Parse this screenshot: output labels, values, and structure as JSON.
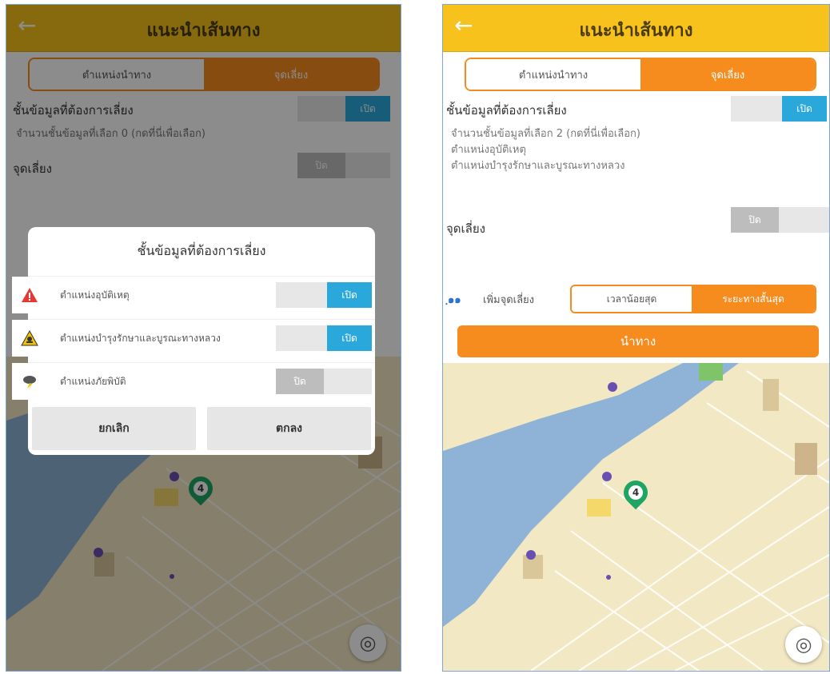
{
  "left": {
    "appbar": {
      "back_icon": "←",
      "title": "แนะนำเส้นทาง"
    },
    "tabs": [
      "ตำแหน่งนำทาง",
      "จุดเลี่ยง"
    ],
    "layers_label": "ชั้นข้อมูลที่ต้องการเลี่ยง",
    "layers_toggle": "เปิด",
    "layers_count": "จำนวนชั้นข้อมูลที่เลือก 0 (กดที่นี่เพื่อเลือก)",
    "avoid_label": "จุดเลี่ยง",
    "avoid_toggle": "ปิด",
    "dialog": {
      "title": "ชั้นข้อมูลที่ต้องการเลี่ยง",
      "rows": [
        {
          "label": "ตำแหน่งอุบัติเหตุ",
          "toggle": "เปิด",
          "icon": "warning-icon"
        },
        {
          "label": "ตำแหน่งบำรุงรักษาและบูรณะทางหลวง",
          "toggle": "เปิด",
          "icon": "construction-icon"
        },
        {
          "label": "ตำแหน่งภัยพิบัติ",
          "toggle": "ปิด",
          "icon": "storm-icon"
        }
      ],
      "cancel": "ยกเลิก",
      "ok": "ตกลง"
    },
    "marker_number": "4",
    "locate_icon": "◎"
  },
  "right": {
    "appbar": {
      "back_icon": "←",
      "title": "แนะนำเส้นทาง"
    },
    "tabs": [
      "ตำแหน่งนำทาง",
      "จุดเลี่ยง"
    ],
    "layers_label": "ชั้นข้อมูลที่ต้องการเลี่ยง",
    "layers_toggle": "เปิด",
    "layers_count": "จำนวนชั้นข้อมูลที่เลือก 2 (กดที่นี่เพื่อเลือก)",
    "layer_items": [
      "ตำแหน่งอุบัติเหตุ",
      "ตำแหน่งบำรุงรักษาและบูรณะทางหลวง"
    ],
    "avoid_label": "จุดเลี่ยง",
    "avoid_toggle": "ปิด",
    "route_icon": "ฺ๑๑",
    "add_stop_label": "เพิ่มจุดเลี่ยง",
    "route_options": [
      "เวลาน้อยสุด",
      "ระยะทางสั้นสุด"
    ],
    "navigate": "นำทาง",
    "marker_number": "4",
    "locate_icon": "◎"
  },
  "colors": {
    "appbar": "#f6c21b",
    "accent": "#f68b1e",
    "toggle_on": "#2aa8dc",
    "map_land": "#f3e8c4",
    "river": "#8fb3d6"
  }
}
